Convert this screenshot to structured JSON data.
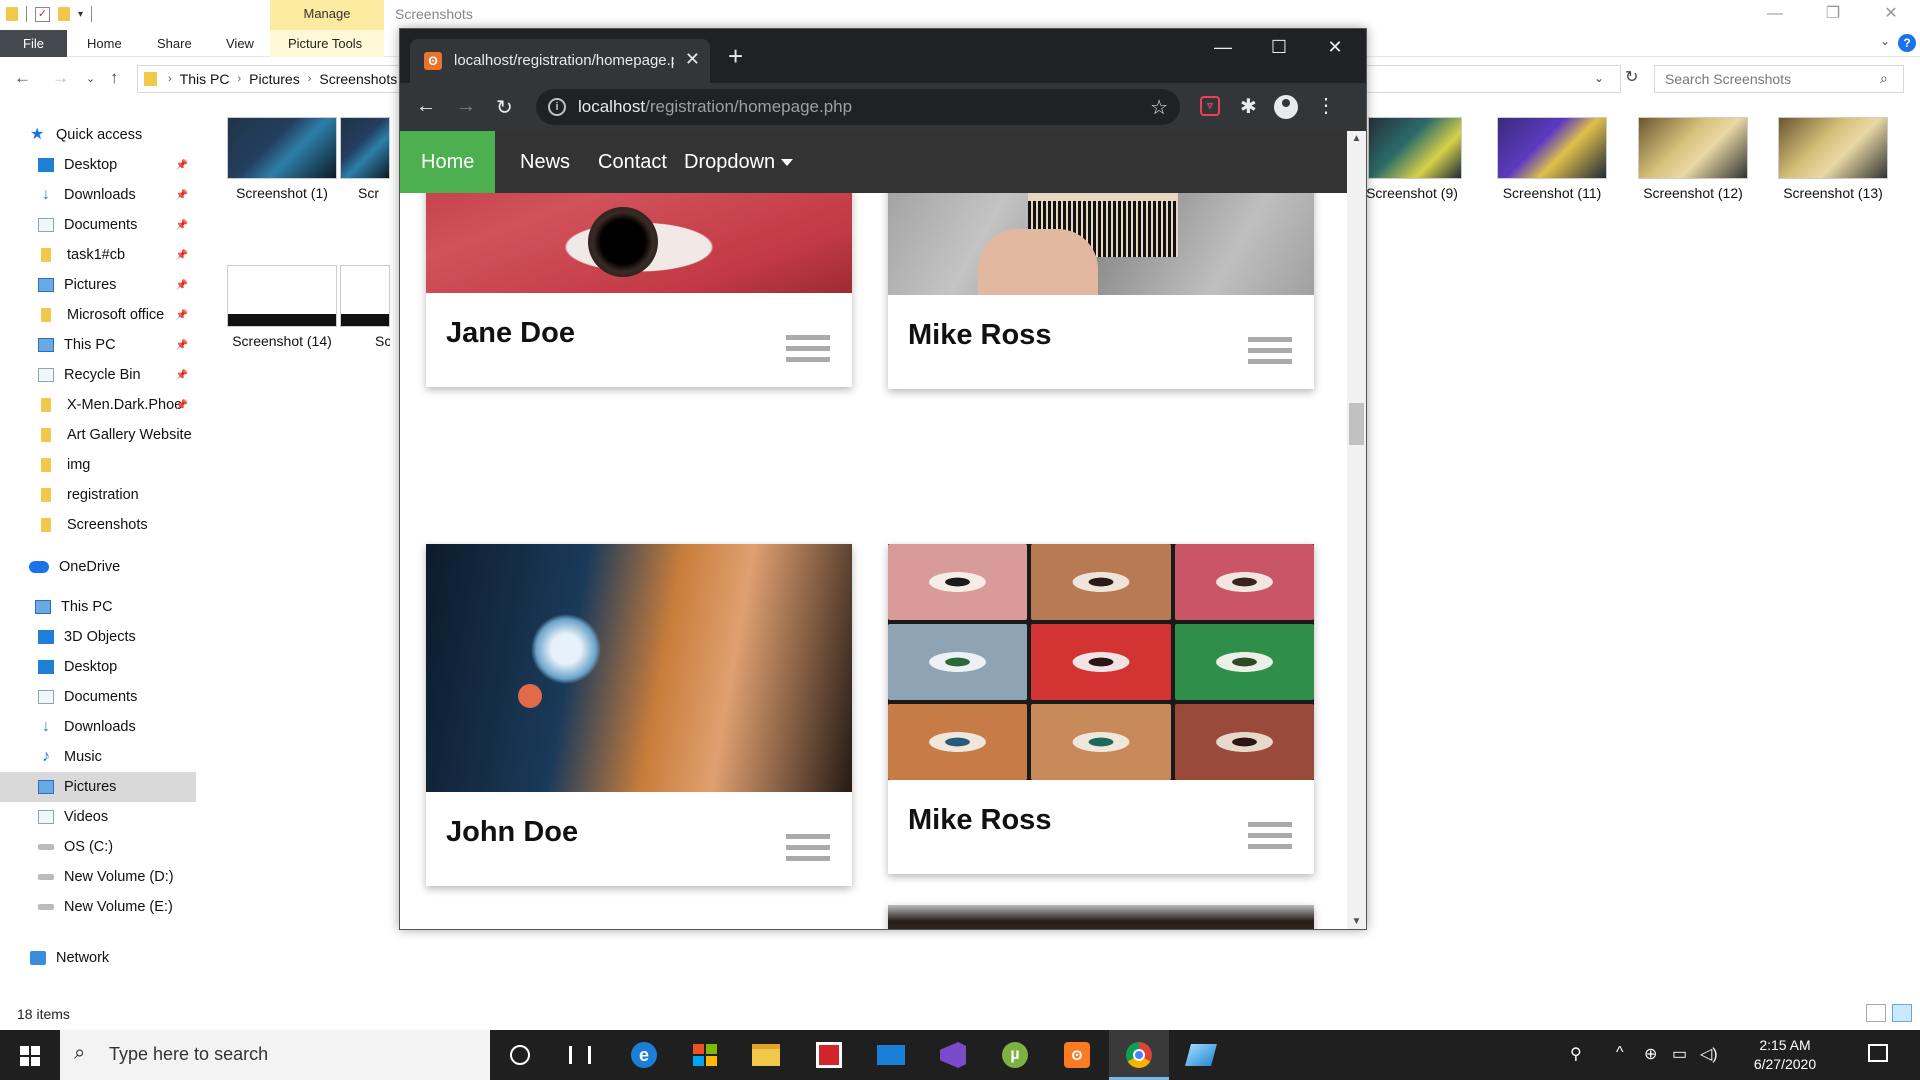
{
  "explorer": {
    "window_title": "Screenshots",
    "ribbon": {
      "context_tab": "Manage",
      "tabs": [
        "File",
        "Home",
        "Share",
        "View",
        "Picture Tools"
      ]
    },
    "breadcrumbs": [
      "This PC",
      "Pictures",
      "Screenshots"
    ],
    "search_placeholder": "Search Screenshots",
    "quick_access_label": "Quick access",
    "nav_items": [
      {
        "label": "Desktop",
        "icon": "desktop-icon",
        "pinned": true
      },
      {
        "label": "Downloads",
        "icon": "download-icon",
        "pinned": true
      },
      {
        "label": "Documents",
        "icon": "documents-icon",
        "pinned": true
      },
      {
        "label": "task1#cb",
        "icon": "folder-icon",
        "pinned": true
      },
      {
        "label": "Pictures",
        "icon": "pictures-icon",
        "pinned": true
      },
      {
        "label": "Microsoft office",
        "icon": "folder-icon",
        "pinned": true
      },
      {
        "label": "This PC",
        "icon": "pc-icon",
        "pinned": true
      },
      {
        "label": "Recycle Bin",
        "icon": "recycle-bin-icon",
        "pinned": true
      },
      {
        "label": "X-Men.Dark.Phoe",
        "icon": "folder-icon",
        "pinned": true
      },
      {
        "label": "Art Gallery Website",
        "icon": "folder-icon"
      },
      {
        "label": "img",
        "icon": "folder-icon"
      },
      {
        "label": "registration",
        "icon": "folder-icon"
      },
      {
        "label": "Screenshots",
        "icon": "folder-icon"
      }
    ],
    "onedrive_label": "OneDrive",
    "thispc_label": "This PC",
    "thispc_items": [
      {
        "label": "3D Objects",
        "icon": "3d-objects-icon"
      },
      {
        "label": "Desktop",
        "icon": "desktop-icon"
      },
      {
        "label": "Documents",
        "icon": "documents-icon"
      },
      {
        "label": "Downloads",
        "icon": "download-icon"
      },
      {
        "label": "Music",
        "icon": "music-icon"
      },
      {
        "label": "Pictures",
        "icon": "pictures-icon"
      },
      {
        "label": "Videos",
        "icon": "videos-icon"
      },
      {
        "label": "OS (C:)",
        "icon": "drive-icon"
      },
      {
        "label": "New Volume (D:)",
        "icon": "drive-icon"
      },
      {
        "label": "New Volume (E:)",
        "icon": "drive-icon"
      }
    ],
    "network_label": "Network",
    "files": [
      {
        "label": "Screenshot (1)"
      },
      {
        "label": "Scr"
      },
      {
        "label": "Screenshot (14)"
      },
      {
        "label": "Scre"
      },
      {
        "label": "Screenshot (9)"
      },
      {
        "label": "Screenshot (11)"
      },
      {
        "label": "Screenshot (12)"
      },
      {
        "label": "Screenshot (13)"
      }
    ],
    "status": "18 items"
  },
  "chrome": {
    "tab_title": "localhost/registration/homepage.php",
    "url_host": "localhost",
    "url_path": "/registration/homepage.php",
    "window_controls": {
      "minimize": "—",
      "maximize": "☐",
      "close": "✕"
    }
  },
  "site": {
    "nav": [
      {
        "label": "Home",
        "active": true
      },
      {
        "label": "News"
      },
      {
        "label": "Contact"
      },
      {
        "label": "Dropdown"
      }
    ],
    "cards": [
      {
        "name": "Jane Doe"
      },
      {
        "name": "Mike Ross"
      },
      {
        "name": "John Doe"
      },
      {
        "name": "Mike Ross"
      }
    ]
  },
  "taskbar": {
    "search_placeholder": "Type here to search",
    "time": "2:15 AM",
    "date": "6/27/2020",
    "active_app": "chrome"
  }
}
